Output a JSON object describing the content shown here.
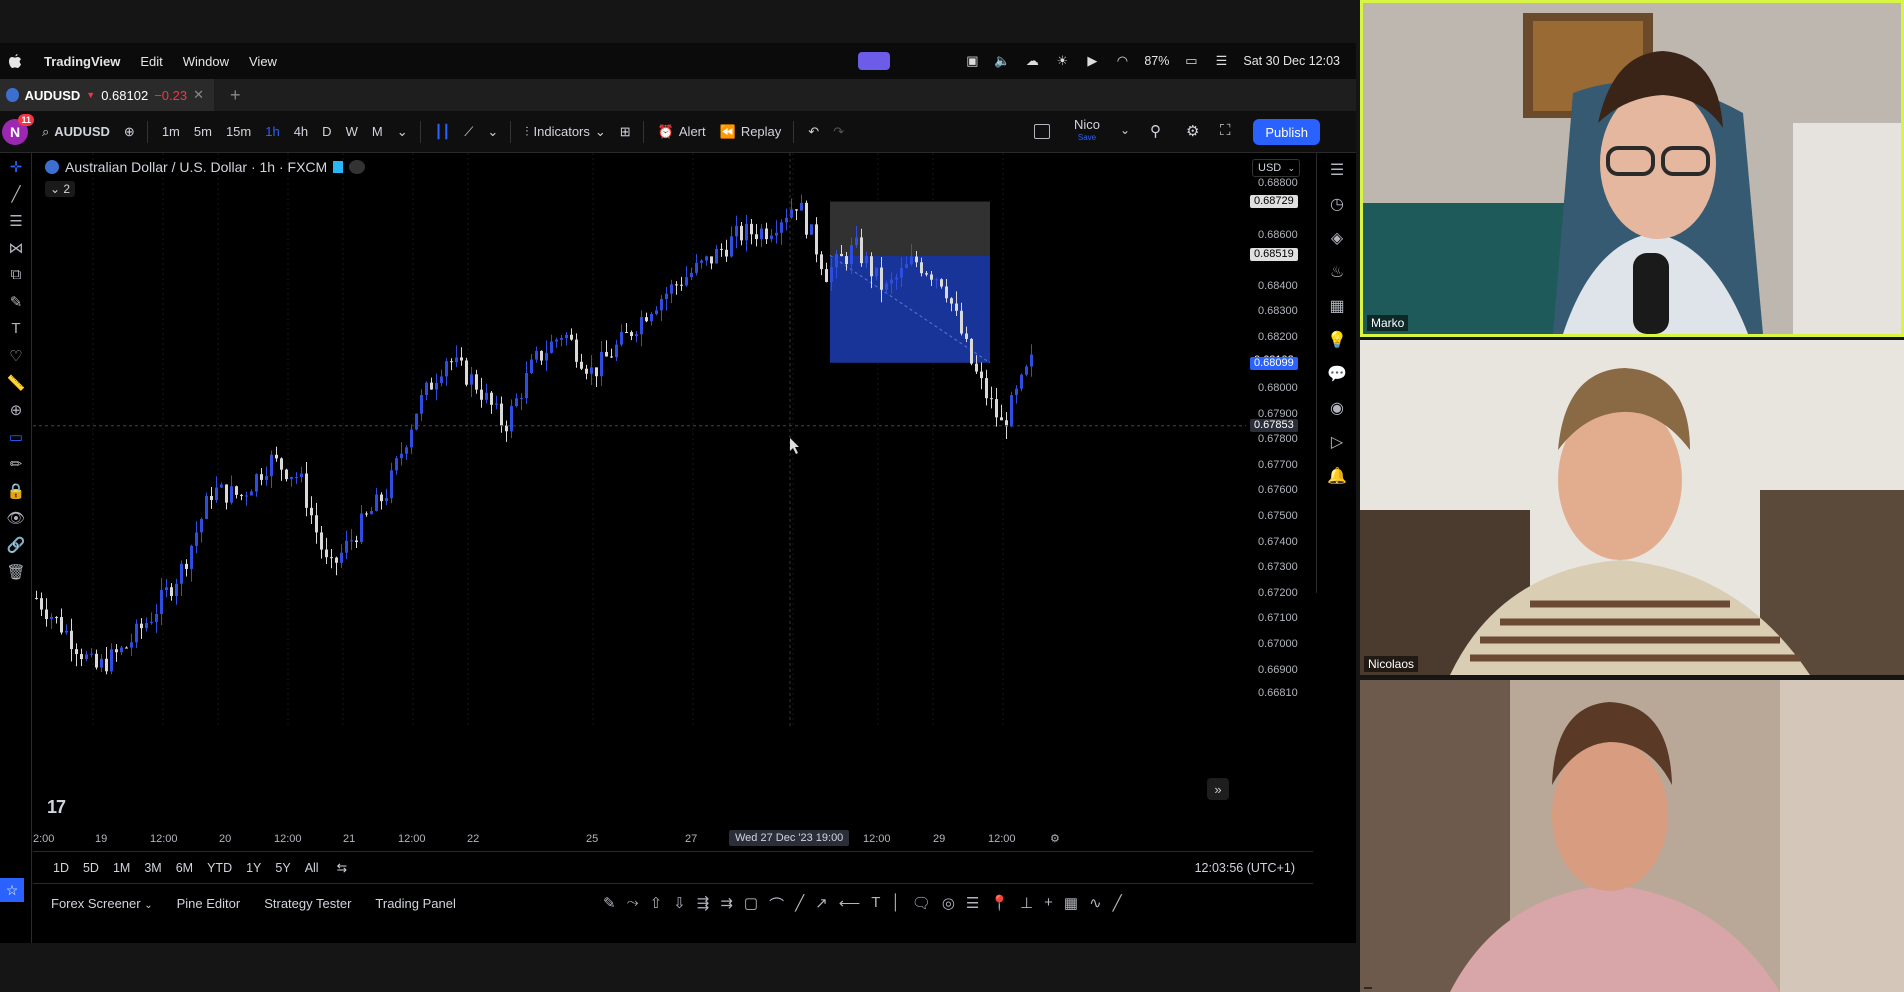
{
  "menubar": {
    "app": "TradingView",
    "items": [
      "Edit",
      "Window",
      "View"
    ],
    "battery": "87%",
    "datetime": "Sat 30 Dec  12:03"
  },
  "tab": {
    "symbol": "AUDUSD",
    "price": "0.68102",
    "change": "−0.23"
  },
  "toolbar": {
    "avatar_letter": "N",
    "notif_count": "11",
    "symbol_search": "AUDUSD",
    "intervals": [
      "1m",
      "5m",
      "15m",
      "1h",
      "4h",
      "D",
      "W",
      "M"
    ],
    "active_interval": "1h",
    "indicators_label": "Indicators",
    "alert_label": "Alert",
    "replay_label": "Replay",
    "layout_name": "Nico",
    "layout_sub": "Save",
    "publish_label": "Publish"
  },
  "chart": {
    "title": "Australian Dollar / U.S. Dollar · 1h · FXCM",
    "indicator_count": "2",
    "currency": "USD",
    "price_labels": [
      "0.68800",
      "0.68600",
      "0.68400",
      "0.68300",
      "0.68200",
      "0.68000",
      "0.67900",
      "0.67800",
      "0.67700",
      "0.67600",
      "0.67500",
      "0.67400",
      "0.67300",
      "0.67200",
      "0.67100",
      "0.67000",
      "0.66900",
      "0.66810"
    ],
    "tag_top": "0.68729",
    "tag_mid": "0.68519",
    "tag_last": "0.68102",
    "tag_current": "0.68099",
    "tag_cross": "0.67853",
    "time_labels": [
      "2:00",
      "19",
      "12:00",
      "20",
      "12:00",
      "21",
      "12:00",
      "22",
      "25",
      "27",
      "12:00",
      "29",
      "12:00"
    ],
    "time_highlight": "Wed 27 Dec '23   19:00",
    "colors": {
      "up": "#2f4ee0",
      "down": "#d9d9d9",
      "box_blue": "#1c3aa8",
      "box_grey": "#3a3a3a",
      "accent": "#2962ff"
    }
  },
  "chart_data": {
    "type": "candlestick",
    "title": "Australian Dollar / U.S. Dollar · 1h · FXCM",
    "ylim": [
      0.6675,
      0.6886
    ],
    "yticks": [
      0.688,
      0.686,
      0.684,
      0.683,
      0.682,
      0.68,
      0.679,
      0.678,
      0.677,
      0.676,
      0.675,
      0.674,
      0.673,
      0.672,
      0.671,
      0.67,
      0.669,
      0.6681
    ],
    "x": [
      "18 22:00",
      "19",
      "19 12:00",
      "20",
      "20 12:00",
      "21",
      "21 12:00",
      "22",
      "25",
      "27",
      "27 19:00",
      "28 12:00",
      "29",
      "29 12:00"
    ],
    "close_path": [
      0.6718,
      0.6705,
      0.669,
      0.6698,
      0.6712,
      0.673,
      0.676,
      0.6758,
      0.6772,
      0.6765,
      0.6728,
      0.6745,
      0.676,
      0.6792,
      0.6812,
      0.6802,
      0.6785,
      0.681,
      0.6822,
      0.6806,
      0.6818,
      0.6832,
      0.6842,
      0.685,
      0.686,
      0.6862,
      0.6873,
      0.6845,
      0.6855,
      0.6838,
      0.685,
      0.6842,
      0.6808,
      0.6785,
      0.681
    ],
    "positions": [
      {
        "type": "short",
        "entry_high": 0.68729,
        "entry_low": 0.68519,
        "target": 0.68099
      }
    ],
    "grid": true
  },
  "rangebar": {
    "ranges": [
      "1D",
      "5D",
      "1M",
      "3M",
      "6M",
      "YTD",
      "1Y",
      "5Y",
      "All"
    ],
    "clock": "12:03:56 (UTC+1)"
  },
  "bottompanel": {
    "tabs": [
      "Forex Screener",
      "Pine Editor",
      "Strategy Tester",
      "Trading Panel"
    ]
  },
  "participants": [
    "Marko",
    "Nicolaos",
    ""
  ]
}
